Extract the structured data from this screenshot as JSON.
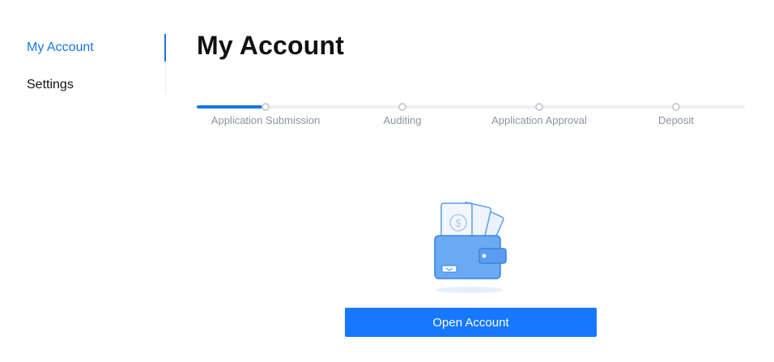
{
  "sidebar": {
    "items": [
      {
        "label": "My Account",
        "active": true
      },
      {
        "label": "Settings",
        "active": false
      }
    ]
  },
  "main": {
    "title": "My Account",
    "progress": {
      "steps": [
        {
          "label": "Application Submission"
        },
        {
          "label": "Auditing"
        },
        {
          "label": "Application Approval"
        },
        {
          "label": "Deposit"
        }
      ],
      "current_step": 1
    },
    "illustration": {
      "icon": "wallet-with-cash-icon"
    },
    "open_account_label": "Open Account"
  },
  "colors": {
    "accent": "#1677e8",
    "button": "#1677ff",
    "muted_text": "#8a94a3",
    "track": "#eef0f3"
  }
}
